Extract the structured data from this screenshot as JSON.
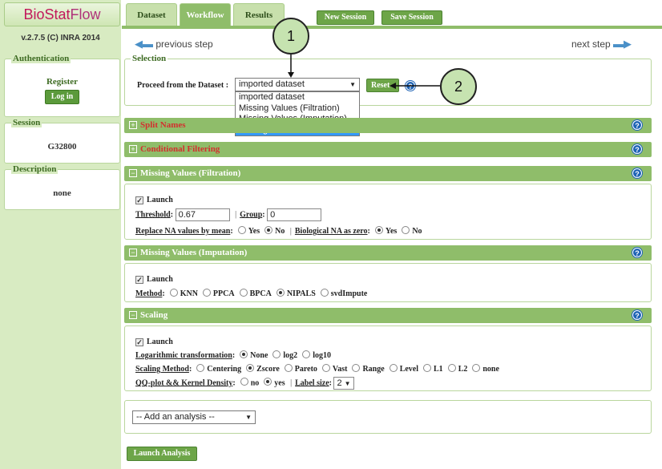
{
  "app": {
    "logo_part1": "BioStat",
    "logo_part2": "Flow",
    "version": "v.2.7.5 (C) INRA 2014"
  },
  "sidebar": {
    "auth_legend": "Authentication",
    "register": "Register",
    "login": "Log in",
    "session_legend": "Session",
    "session_id": "G32800",
    "description_legend": "Description",
    "description": "none"
  },
  "tabs": [
    {
      "label": "Dataset"
    },
    {
      "label": "Workflow"
    },
    {
      "label": "Results"
    }
  ],
  "header_buttons": {
    "new_session": "New Session",
    "save_session": "Save Session"
  },
  "nav": {
    "previous": "previous step",
    "next": "next step"
  },
  "selection": {
    "legend": "Selection",
    "label": "Proceed from the Dataset :",
    "selected": "imported dataset",
    "options": [
      "imported dataset",
      "Missing Values (Filtration)",
      "Missing Values (Imputation)",
      "Scaling"
    ],
    "highlighted": "Scaling",
    "reset": "Reset"
  },
  "callouts": [
    "1",
    "2"
  ],
  "sections": {
    "split_names": "Split Names",
    "conditional_filtering": "Conditional Filtering",
    "mv_filtration": "Missing Values (Filtration)",
    "mv_imputation": "Missing Values (Imputation)",
    "scaling": "Scaling"
  },
  "filtration": {
    "launch": "Launch",
    "threshold_label": "Threshold",
    "threshold_value": "0.67",
    "group_label": "Group",
    "group_value": "0",
    "replace_label": "Replace NA values by mean",
    "replace_yes": "Yes",
    "replace_no": "No",
    "bio_label": "Biological NA as zero",
    "bio_yes": "Yes",
    "bio_no": "No"
  },
  "imputation": {
    "launch": "Launch",
    "method_label": "Method",
    "methods": [
      "KNN",
      "PPCA",
      "BPCA",
      "NIPALS",
      "svdImpute"
    ]
  },
  "scaling": {
    "launch": "Launch",
    "log_label": "Logarithmic transformation",
    "log_options": [
      "None",
      "log2",
      "log10"
    ],
    "method_label": "Scaling Method",
    "methods": [
      "Centering",
      "Zscore",
      "Pareto",
      "Vast",
      "Range",
      "Level",
      "L1",
      "L2",
      "none"
    ],
    "qq_label": "QQ-plot && Kernel Density",
    "qq_no": "no",
    "qq_yes": "yes",
    "label_size_label": "Label size",
    "label_size_value": "2"
  },
  "add_analysis": "-- Add an analysis --",
  "launch_analysis": "Launch Analysis"
}
